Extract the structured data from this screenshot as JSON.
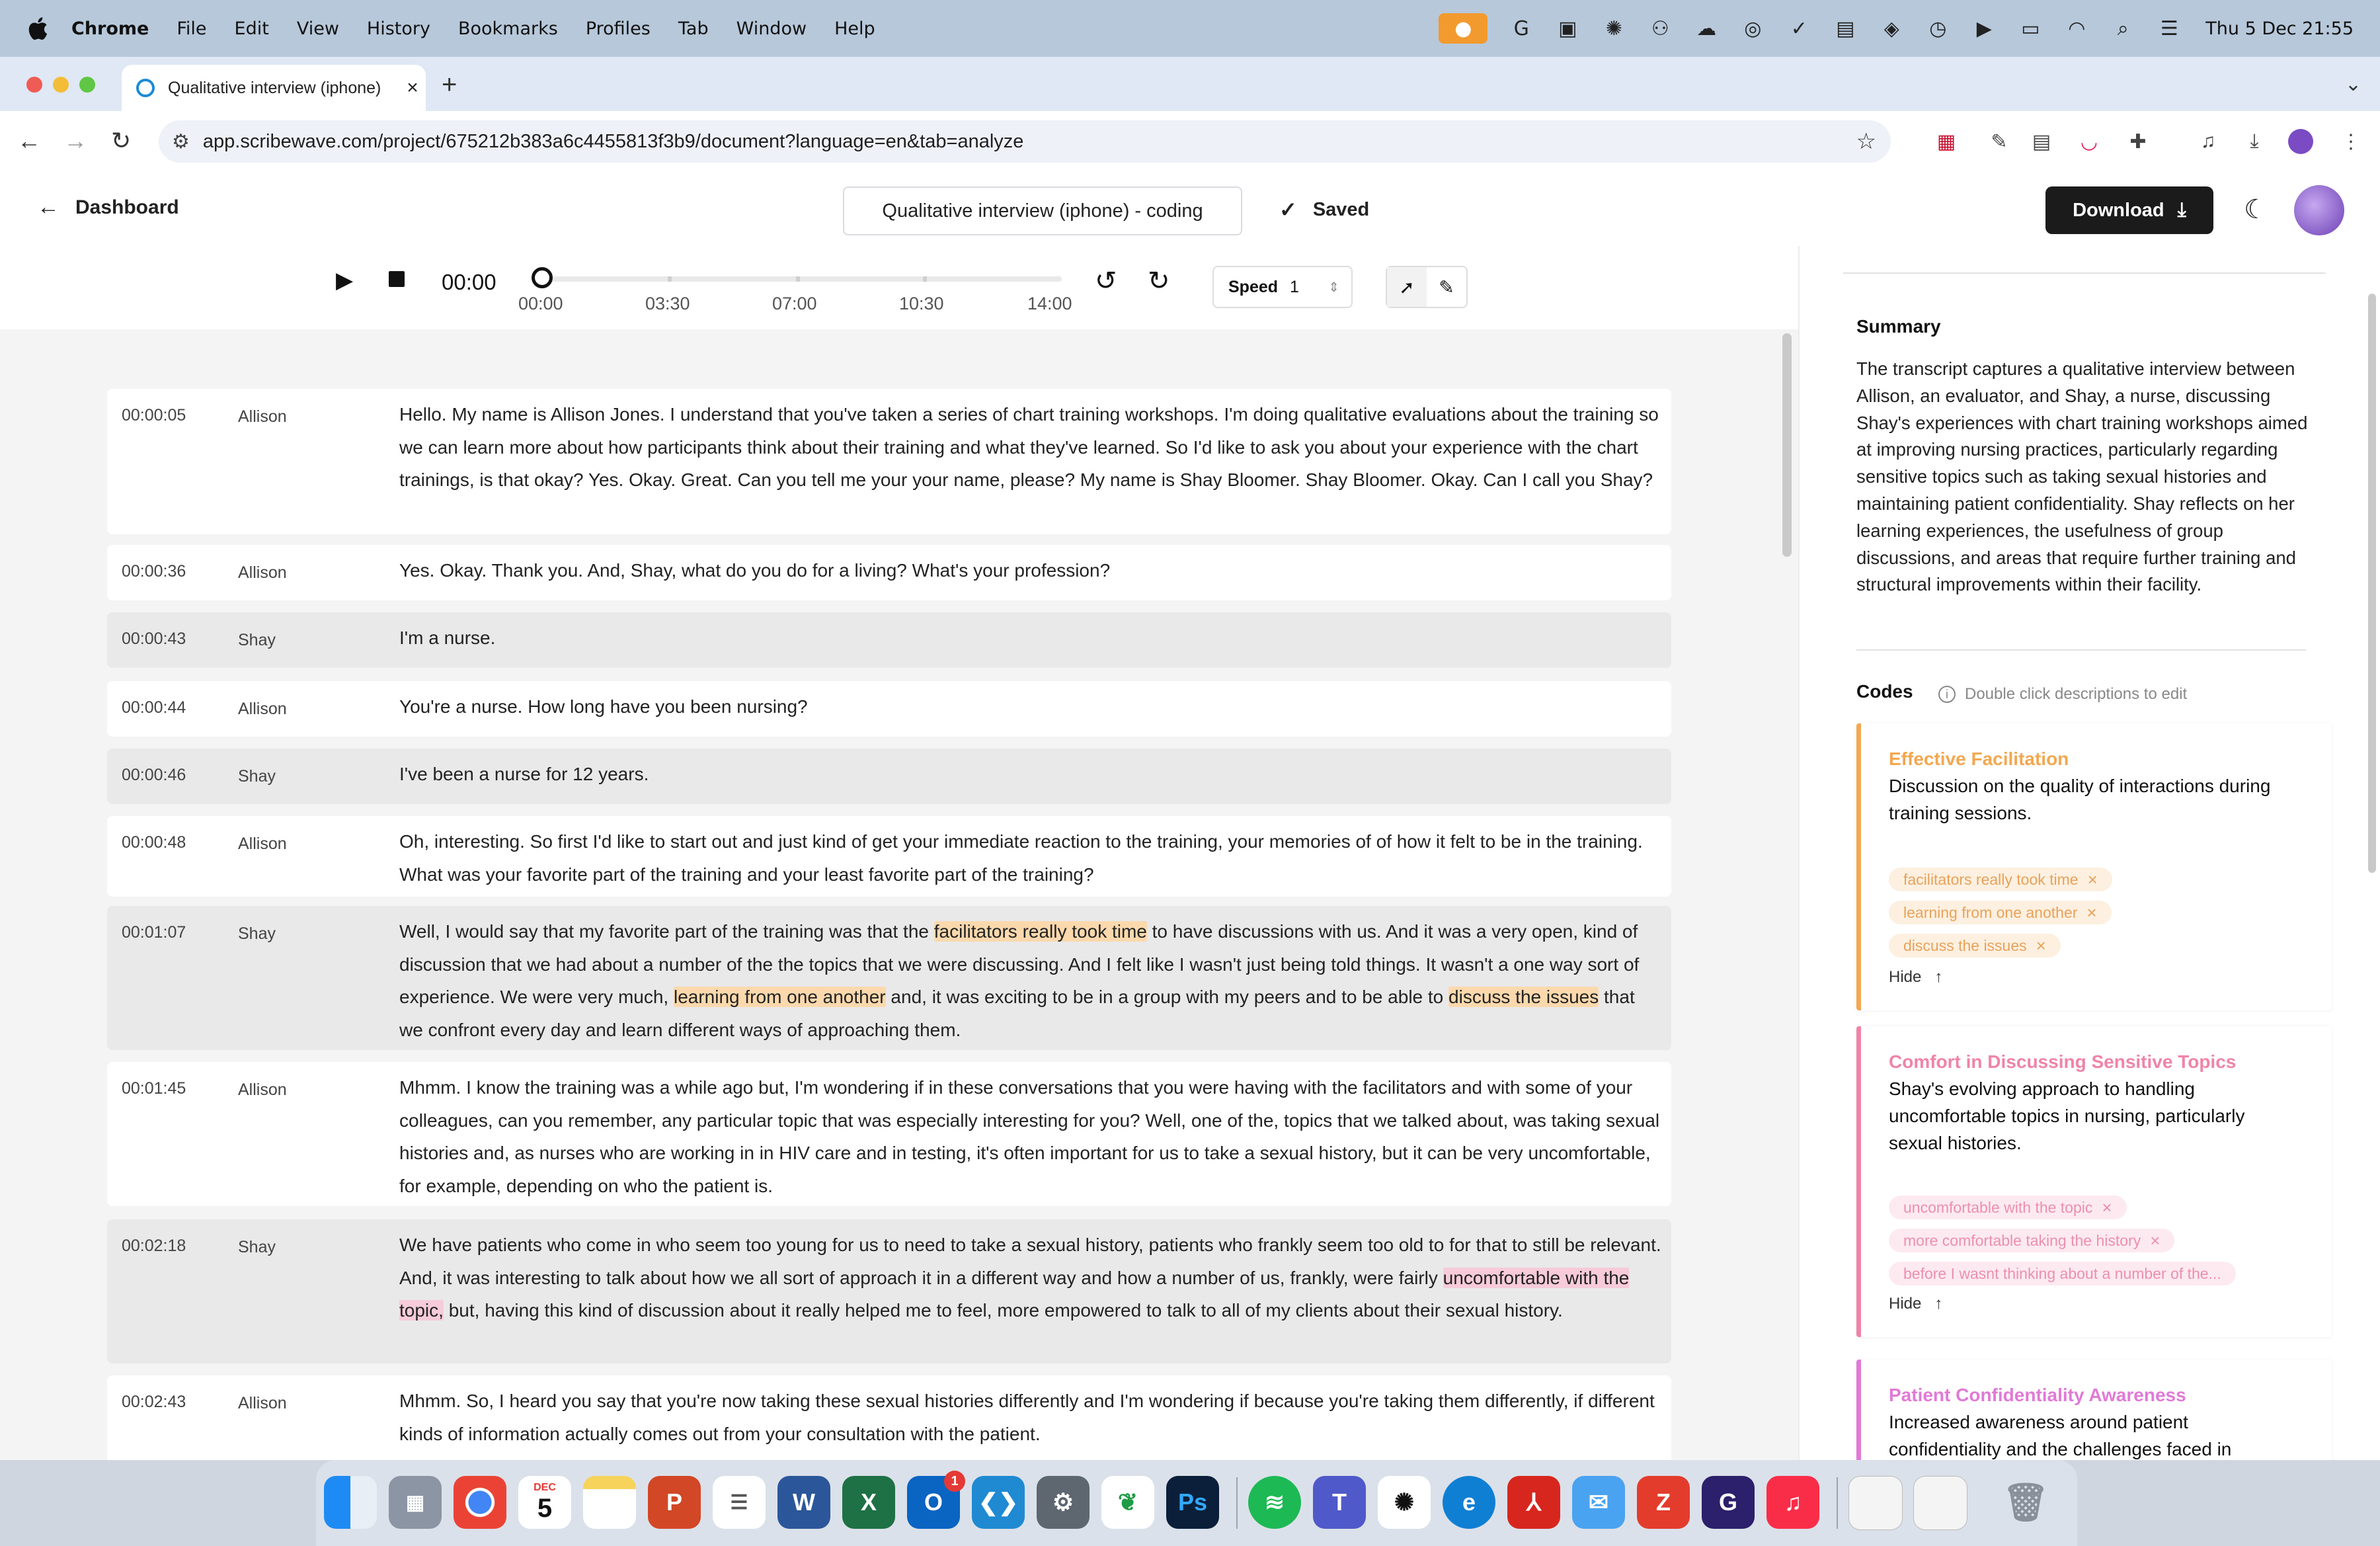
{
  "menubar": {
    "app": "Chrome",
    "items": [
      "File",
      "Edit",
      "View",
      "History",
      "Bookmarks",
      "Profiles",
      "Tab",
      "Window",
      "Help"
    ],
    "clock": "Thu 5 Dec  21:55"
  },
  "browser": {
    "tab_title": "Qualitative interview (iphone)",
    "url": "app.scribewave.com/project/675212b383a6c4455813f3b9/document?language=en&tab=analyze"
  },
  "app": {
    "back_label": "Dashboard",
    "document_title": "Qualitative interview (iphone) - coding",
    "saved_label": "Saved",
    "download_label": "Download"
  },
  "player": {
    "current_time": "00:00",
    "tick_labels": [
      "00:00",
      "03:30",
      "07:00",
      "10:30",
      "14:00"
    ],
    "speed_label": "Speed",
    "speed_value": "1",
    "progress": 0.0
  },
  "transcript": [
    {
      "time": "00:00:05",
      "speaker": "Allison",
      "parts": [
        {
          "t": "Hello. My name is Allison Jones. I understand that you've taken a series of chart training workshops. I'm doing qualitative evaluations about the training so we can learn more about how participants think about their training and what they've learned. So I'd like to ask you about your experience with the chart trainings, is that okay? Yes. Okay. Great. Can you tell me your your name, please? My name is Shay Bloomer. Shay Bloomer. Okay. Can I call you Shay?"
        }
      ]
    },
    {
      "time": "00:00:36",
      "speaker": "Allison",
      "parts": [
        {
          "t": "Yes. Okay. Thank you. And, Shay, what do you do for a living? What's your profession?"
        }
      ]
    },
    {
      "time": "00:00:43",
      "speaker": "Shay",
      "parts": [
        {
          "t": "I'm a nurse."
        }
      ]
    },
    {
      "time": "00:00:44",
      "speaker": "Allison",
      "parts": [
        {
          "t": "You're a nurse. How long have you been nursing?"
        }
      ]
    },
    {
      "time": "00:00:46",
      "speaker": "Shay",
      "parts": [
        {
          "t": "I've been a nurse for 12 years."
        }
      ]
    },
    {
      "time": "00:00:48",
      "speaker": "Allison",
      "parts": [
        {
          "t": "Oh, interesting. So first I'd like to start out and just kind of get your immediate reaction to the training, your memories of of how it felt to be in the training. What was your favorite part of the training and your least favorite part of the training?"
        }
      ]
    },
    {
      "time": "00:01:07",
      "speaker": "Shay",
      "parts": [
        {
          "t": "Well, I would say that my favorite part of the training was that the "
        },
        {
          "t": "facilitators really took time",
          "hl": "o"
        },
        {
          "t": " to have discussions with us. And it was a very open, kind of discussion that we had about a number of the the topics that we were discussing. And I felt like I wasn't just being told things. It wasn't a one way sort of experience. We were very much, "
        },
        {
          "t": "learning from one another",
          "hl": "o"
        },
        {
          "t": " and, it was exciting to be in a group with my peers and to be able to "
        },
        {
          "t": "discuss the issues",
          "hl": "o"
        },
        {
          "t": " that we confront every day and learn different ways of approaching them."
        }
      ]
    },
    {
      "time": "00:01:45",
      "speaker": "Allison",
      "parts": [
        {
          "t": "Mhmm. I know the training was a while ago but, I'm wondering if in these conversations that you were having with the facilitators and with some of your colleagues, can you remember, any particular topic that was especially interesting for you? Well, one of the, topics that we talked about, was taking sexual histories and, as nurses who are working in in HIV care and in testing, it's often important for us to take a sexual history, but it can be very uncomfortable, for example, depending on who the patient is."
        }
      ]
    },
    {
      "time": "00:02:18",
      "speaker": "Shay",
      "parts": [
        {
          "t": "We have patients who come in who seem too young for us to need to take a sexual history, patients who frankly seem too old to for that to still be relevant. And, it was interesting to talk about how we all sort of approach it in a different way and how a number of us, frankly, were fairly "
        },
        {
          "t": "uncomfortable with the topic,",
          "hl": "p"
        },
        {
          "t": " but, having this kind of discussion about it really helped me to feel, more empowered to talk to all of my clients about their sexual history."
        }
      ]
    },
    {
      "time": "00:02:43",
      "speaker": "Allison",
      "parts": [
        {
          "t": "Mhmm. So, I heard you say that you're now taking these sexual histories differently and I'm wondering if because you're taking them differently, if different kinds of information actually comes out from your consultation with the patient."
        }
      ]
    }
  ],
  "panel": {
    "summary_heading": "Summary",
    "summary": "The transcript captures a qualitative interview between Allison, an evaluator, and Shay, a nurse, discussing Shay's experiences with chart training workshops aimed at improving nursing practices, particularly regarding sensitive topics such as taking sexual histories and maintaining patient confidentiality. Shay reflects on her learning experiences, the usefulness of group discussions, and areas that require further training and structural improvements within their facility.",
    "codes_heading": "Codes",
    "codes_hint": "Double click descriptions to edit",
    "hide_label": "Hide",
    "codes": [
      {
        "title": "Effective Facilitation",
        "description": "Discussion on the quality of interactions during training sessions.",
        "color": "#f2a851",
        "chip_bg": "#fdf0e0",
        "chip_fg": "#e8a25a",
        "quotes": [
          "facilitators really took time",
          "learning from one another",
          "discuss the issues"
        ]
      },
      {
        "title": "Comfort in Discussing Sensitive Topics",
        "description": "Shay's evolving approach to handling uncomfortable topics in nursing, particularly sexual histories.",
        "color": "#ef84a8",
        "chip_bg": "#fdeaf0",
        "chip_fg": "#ec8fae",
        "quotes": [
          "uncomfortable with the topic",
          "more comfortable taking the history",
          "before I wasnt thinking about a number of the..."
        ]
      },
      {
        "title": "Patient Confidentiality Awareness",
        "description": "Increased awareness around patient confidentiality and the challenges faced in",
        "color": "#e07ad6",
        "chip_bg": "#fbe9f8",
        "chip_fg": "#e07ad6",
        "quotes": []
      }
    ]
  },
  "dock": {
    "calendar_month": "DEC",
    "calendar_day": "5",
    "outlook_badge": "1"
  }
}
